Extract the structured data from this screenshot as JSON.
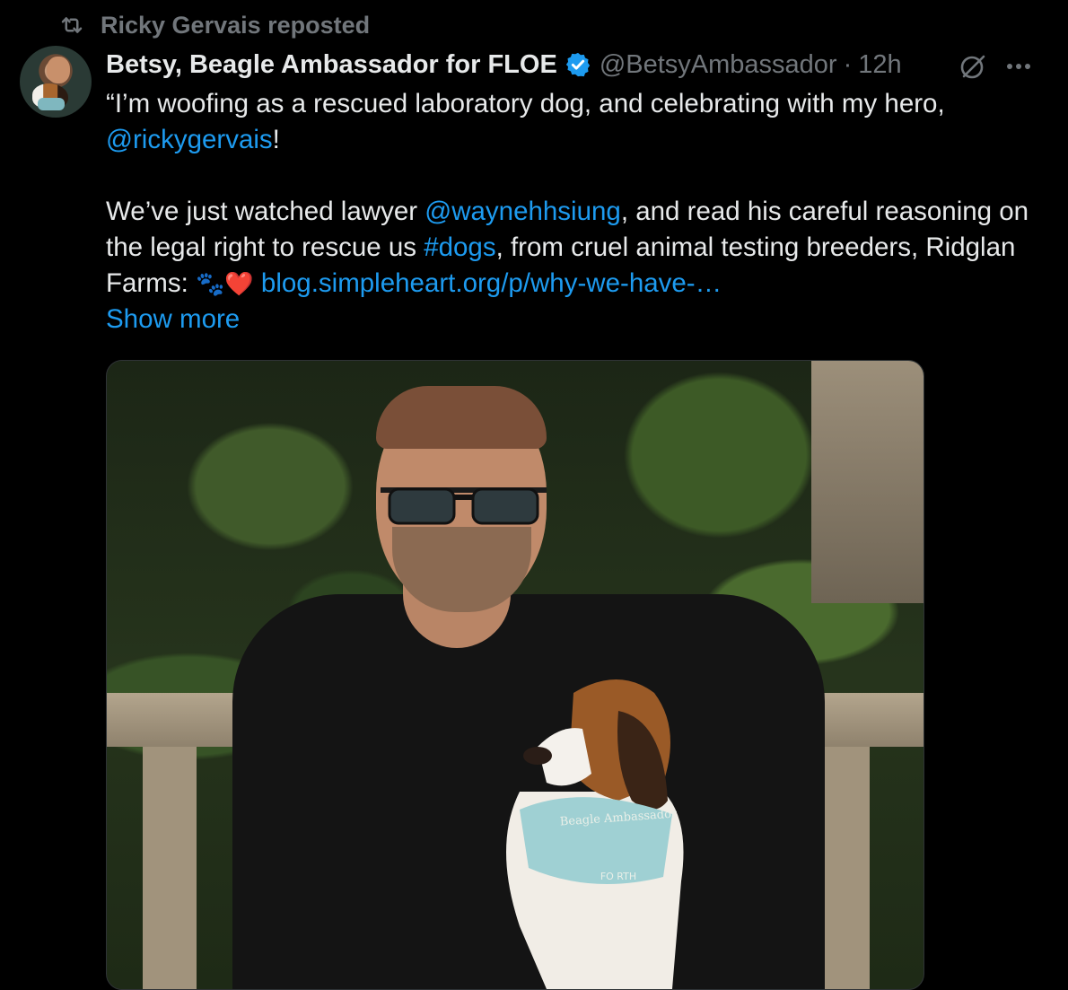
{
  "repost": {
    "label": "Ricky Gervais reposted",
    "icon": "repost-icon"
  },
  "tweet": {
    "author_name": "Betsy, Beagle Ambassador for FLOE",
    "handle": "@BetsyAmbassador",
    "separator": "·",
    "time": "12h",
    "verified_icon": "verified-badge-icon",
    "colors": {
      "background": "#000000",
      "text": "#e7e9ea",
      "muted": "#71767b",
      "link": "#1d9bf0"
    },
    "text": {
      "p1_start": "“I’m woofing as a rescued laboratory dog, and celebrating with my hero,",
      "p1_mention": "@rickygervais",
      "p1_end": "!",
      "p2_start": "We’ve just watched lawyer ",
      "p2_mention": "@waynehhsiung",
      "p2_mid": ", and read his careful reasoning on the legal right to rescue us ",
      "p2_hashtag": "#dogs",
      "p2_mid2": ", from cruel animal testing breeders, Ridglan Farms: ",
      "p2_emojis": "🐾❤️",
      "p2_link": "blog.simpleheart.org/p/why-we-have-…",
      "show_more": "Show more"
    },
    "media": {
      "bandana_text": "Beagle Ambassador",
      "bandana_sub": "FO        RTH"
    },
    "actions": {
      "grok_icon": "grok-icon",
      "more_icon": "more-options-icon"
    }
  }
}
